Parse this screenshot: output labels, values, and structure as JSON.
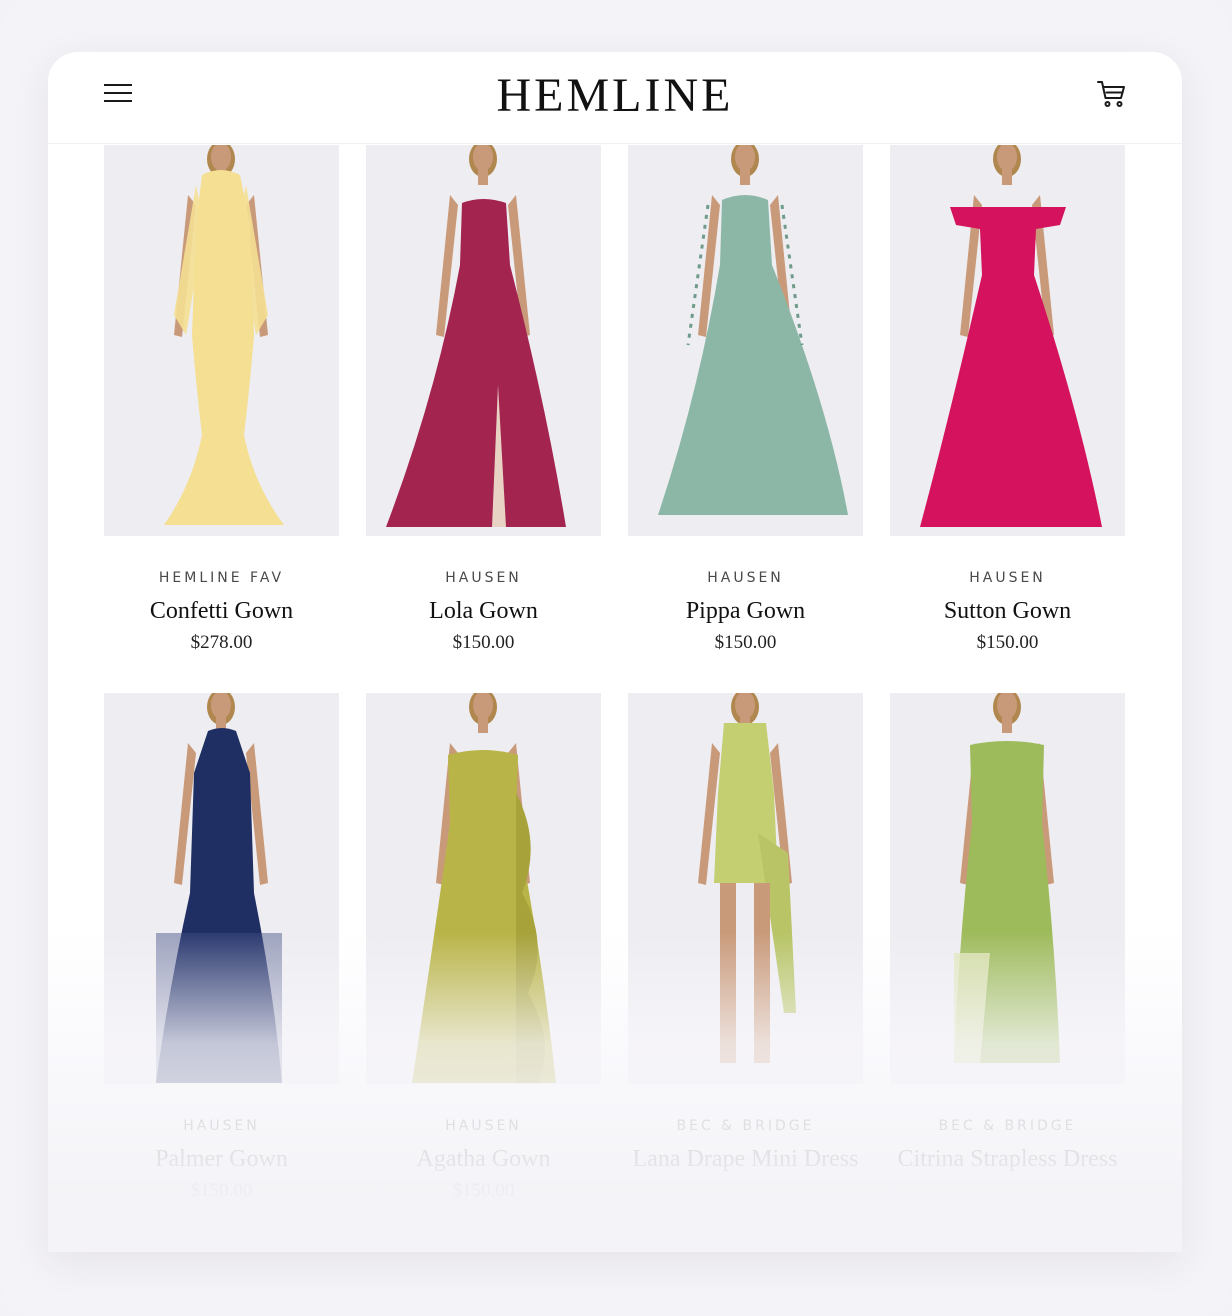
{
  "header": {
    "logo": "HEMLINE",
    "menu_icon": "hamburger-menu-icon",
    "cart_icon": "shopping-cart-icon"
  },
  "products": [
    {
      "brand": "HEMLINE FAV",
      "name": "Confetti Gown",
      "price": "$278.00",
      "color": "#f4df92",
      "style": "long-sleeve-mermaid"
    },
    {
      "brand": "HAUSEN",
      "name": "Lola Gown",
      "price": "$150.00",
      "color": "#a3244f",
      "style": "strapless-slit"
    },
    {
      "brand": "HAUSEN",
      "name": "Pippa Gown",
      "price": "$150.00",
      "color": "#8cb7a6",
      "style": "corset-flowy"
    },
    {
      "brand": "HAUSEN",
      "name": "Sutton Gown",
      "price": "$150.00",
      "color": "#d4125d",
      "style": "off-shoulder-ballgown"
    },
    {
      "brand": "HAUSEN",
      "name": "Palmer Gown",
      "price": "$150.00",
      "color": "#1f2f63",
      "style": "halter-tiered"
    },
    {
      "brand": "HAUSEN",
      "name": "Agatha Gown",
      "price": "$150.00",
      "color": "#b9b447",
      "style": "ruffle-strapless"
    },
    {
      "brand": "BEC & BRIDGE",
      "name": "Lana Drape Mini Dress",
      "price": "",
      "color": "#c4cf71",
      "style": "mini-drape"
    },
    {
      "brand": "BEC & BRIDGE",
      "name": "Citrina Strapless Dress",
      "price": "",
      "color": "#9ebb5c",
      "style": "strapless-column"
    }
  ]
}
